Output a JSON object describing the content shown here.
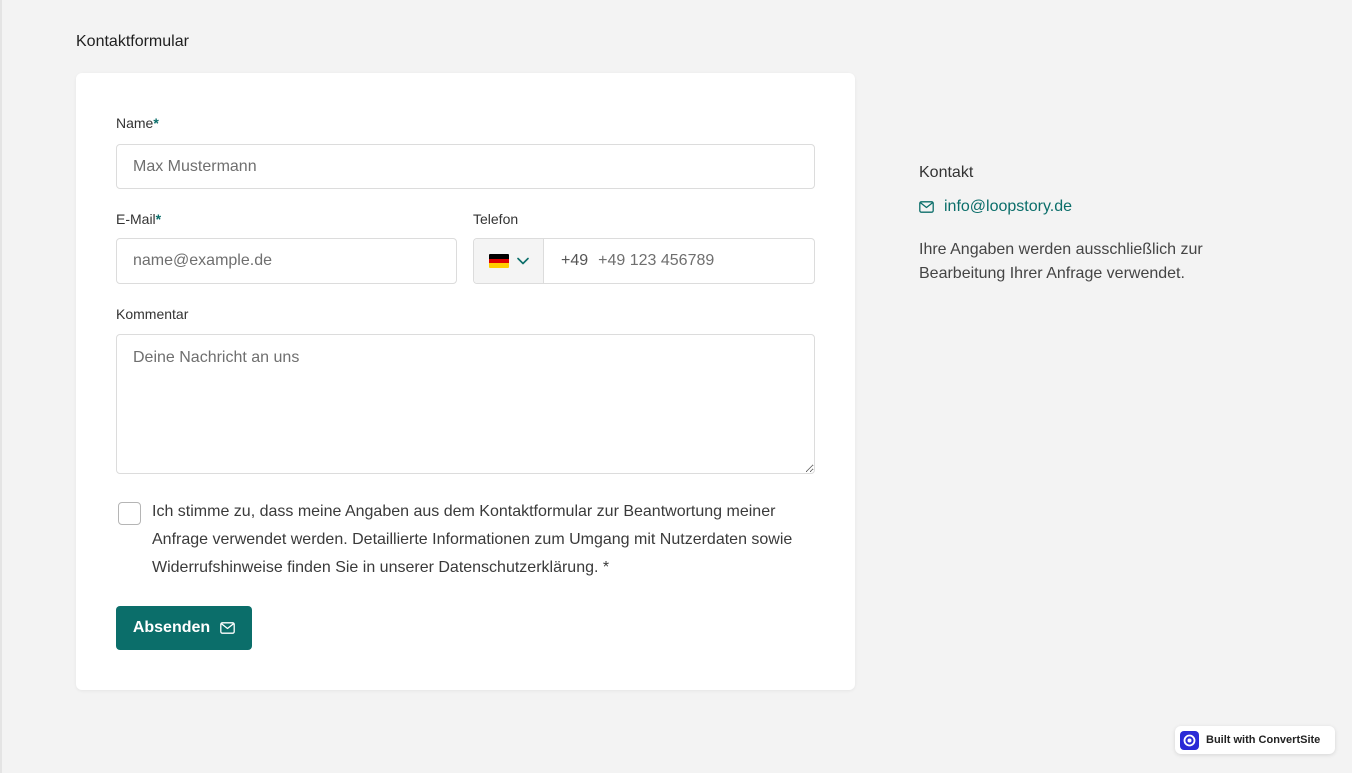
{
  "page": {
    "title": "Kontaktformular"
  },
  "form": {
    "name": {
      "label": "Name",
      "required_mark": "*",
      "placeholder": "Max Mustermann"
    },
    "email": {
      "label": "E-Mail",
      "required_mark": "*",
      "placeholder": "name@example.de"
    },
    "phone": {
      "label": "Telefon",
      "country_icon": "flag-de-icon",
      "prefix": "+49",
      "placeholder": "+49 123 456789"
    },
    "comment": {
      "label": "Kommentar",
      "placeholder": "Deine Nachricht an uns"
    },
    "consent": {
      "text": "Ich stimme zu, dass meine Angaben aus dem Kontaktformular zur Beantwortung meiner Anfrage verwendet werden. Detaillierte Informationen zum Umgang mit Nutzerdaten sowie Widerrufshinweise finden Sie in unserer Datenschutzerklärung. *",
      "checked": false
    },
    "submit": {
      "label": "Absenden",
      "icon": "mail-icon"
    }
  },
  "sidebar": {
    "title": "Kontakt",
    "email": "info@loopstory.de",
    "email_icon": "mail-icon",
    "note": "Ihre Angaben werden ausschließlich zur Bearbeitung Ihrer Anfrage verwendet."
  },
  "badge": {
    "label": "Built with ConvertSite"
  },
  "colors": {
    "accent": "#0b6e6a",
    "background": "#f3f3f3",
    "card": "#ffffff",
    "badge_logo": "#2a2ad6"
  }
}
